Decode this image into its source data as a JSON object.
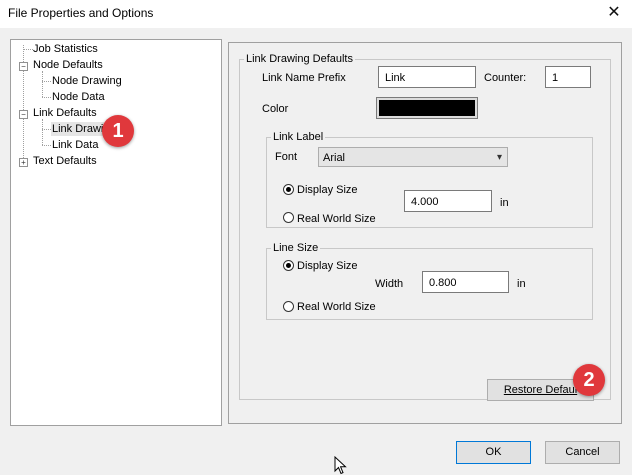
{
  "window": {
    "title": "File Properties and Options",
    "close_glyph": "✕"
  },
  "tree": {
    "items": [
      {
        "label": "Job Statistics"
      },
      {
        "label": "Node Defaults"
      },
      {
        "label": "Node Drawing"
      },
      {
        "label": "Node Data"
      },
      {
        "label": "Link Defaults"
      },
      {
        "label": "Link Drawi"
      },
      {
        "label": "Link Data"
      },
      {
        "label": "Text Defaults"
      }
    ]
  },
  "annotations": {
    "badge1": "1",
    "badge2": "2"
  },
  "link_drawing": {
    "group_title": "Link Drawing Defaults",
    "prefix_label": "Link Name Prefix",
    "prefix_value": "Link",
    "counter_label": "Counter:",
    "counter_value": "1",
    "color_label": "Color",
    "color_value": "#000000"
  },
  "link_label": {
    "group_title": "Link Label",
    "font_label": "Font",
    "font_value": "Arial",
    "display_size": "Display Size",
    "real_world_size": "Real World Size",
    "size_value": "4.000",
    "unit": "in"
  },
  "line_size": {
    "group_title": "Line Size",
    "display_size": "Display Size",
    "real_world_size": "Real World Size",
    "width_label": "Width",
    "width_value": "0.800",
    "unit": "in"
  },
  "buttons": {
    "restore": "Restore Defaul",
    "ok": "OK",
    "cancel": "Cancel"
  }
}
